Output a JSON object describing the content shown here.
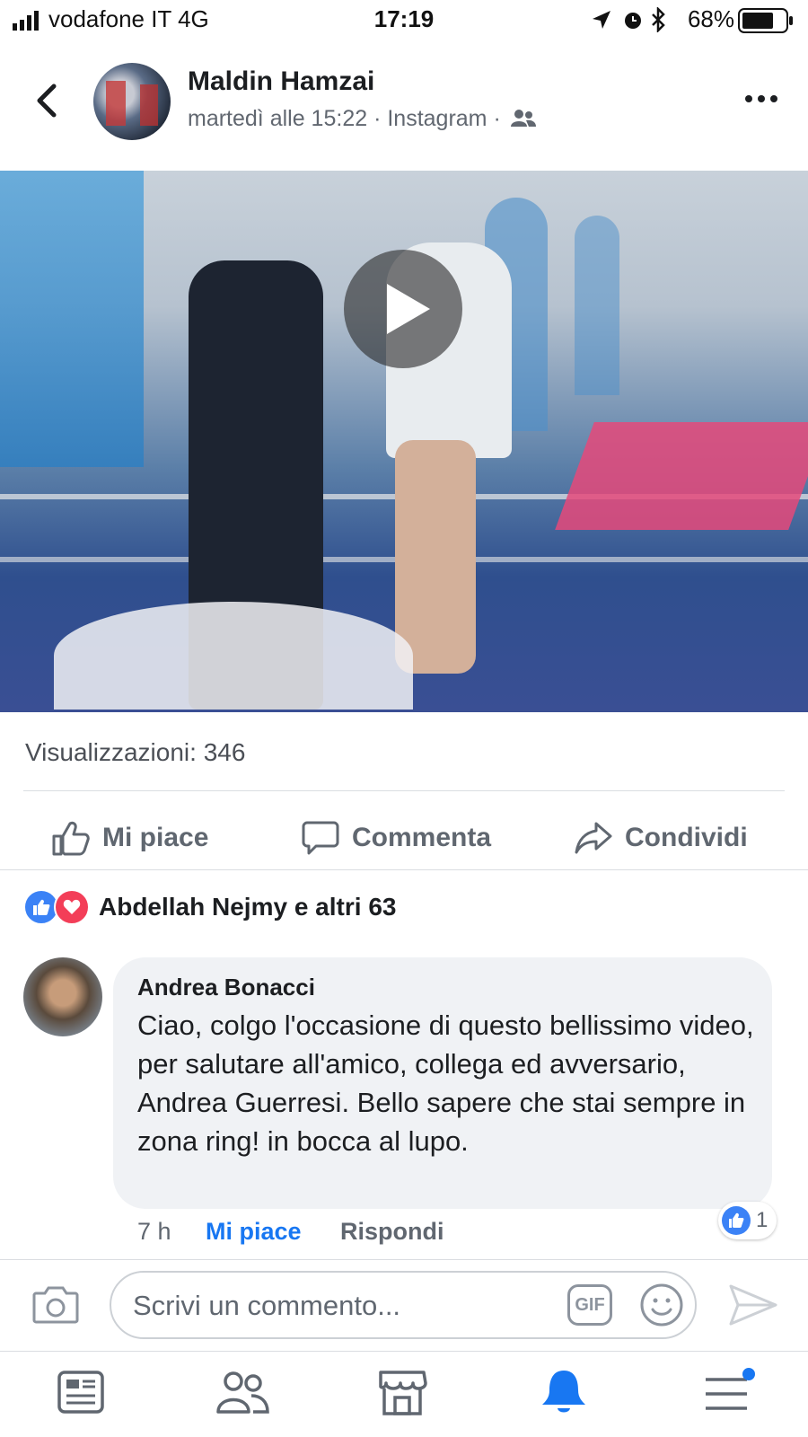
{
  "status_bar": {
    "carrier": "vodafone IT   4G",
    "time": "17:19",
    "battery": "68%"
  },
  "post": {
    "author": "Maldin Hamzai",
    "meta": "martedì alle 15:22 · Instagram ·",
    "views": "Visualizzazioni: 346"
  },
  "actions": {
    "like": "Mi piace",
    "comment": "Commenta",
    "share": "Condividi"
  },
  "reactions": {
    "summary": "Abdellah Nejmy e altri 63"
  },
  "comment": {
    "author": "Andrea Bonacci",
    "text": "Ciao, colgo l'occasione di questo bellissimo video, per salutare all'amico, collega ed avversario, Andrea Guerresi. Bello sapere che stai sempre in zona ring! in bocca al lupo.",
    "time": "7 h",
    "like_label": "Mi piace",
    "reply_label": "Rispondi",
    "reaction_count": "1"
  },
  "composer": {
    "placeholder": "Scrivi un commento...",
    "gif_label": "GIF"
  },
  "colors": {
    "accent": "#1877f2",
    "love": "#f33e58",
    "text": "#1c1e21",
    "muted": "#606770"
  },
  "tabbar": {
    "items": [
      "news-feed-icon",
      "friends-icon",
      "marketplace-icon",
      "notifications-icon",
      "menu-icon"
    ],
    "active": "notifications-icon"
  }
}
